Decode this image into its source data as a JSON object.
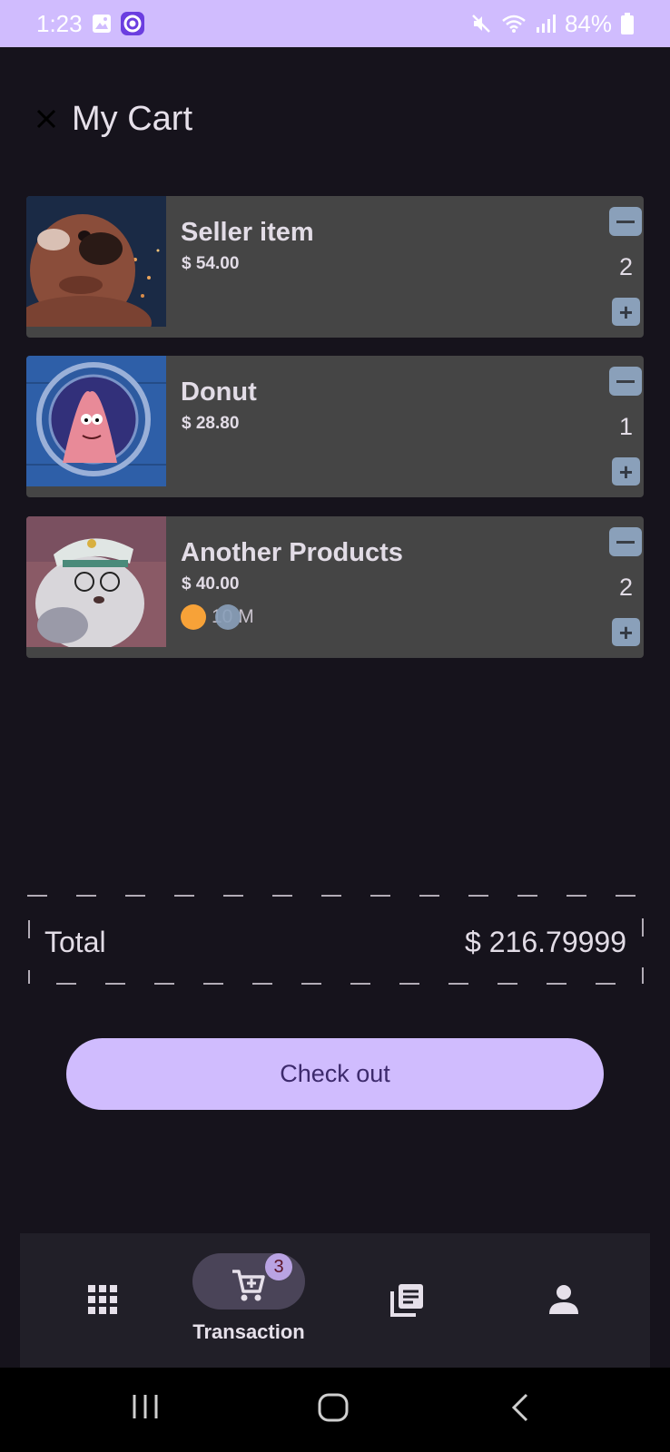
{
  "status_bar": {
    "time": "1:23",
    "battery": "84%",
    "icons": [
      "gallery-icon",
      "record-icon",
      "mute-icon",
      "wifi-icon",
      "signal-icon",
      "battery-icon"
    ]
  },
  "app_bar": {
    "title": "My Cart",
    "close_icon": "close-icon"
  },
  "cart": {
    "items": [
      {
        "name": "Seller item",
        "price": "$ 54.00",
        "quantity": "2"
      },
      {
        "name": "Donut",
        "price": "$ 28.80",
        "quantity": "1"
      },
      {
        "name": "Another Products",
        "price": "$ 40.00",
        "quantity": "2",
        "variant": "10 M",
        "variant_colors": [
          "#f7a238",
          "#8aa0ba"
        ]
      }
    ]
  },
  "total": {
    "label": "Total",
    "value": "$ 216.79999"
  },
  "checkout": {
    "label": "Check out"
  },
  "bottom_nav": {
    "items": [
      {
        "icon": "grid-icon",
        "label": ""
      },
      {
        "icon": "cart-icon",
        "label": "Transaction",
        "badge": "3",
        "selected": true
      },
      {
        "icon": "library-icon",
        "label": ""
      },
      {
        "icon": "person-icon",
        "label": ""
      }
    ]
  },
  "colors": {
    "background": "#16131c",
    "accent": "#d0bcfe",
    "card": "#454545",
    "qty_button": "#8aa0ba",
    "nav_background": "#211f28"
  }
}
